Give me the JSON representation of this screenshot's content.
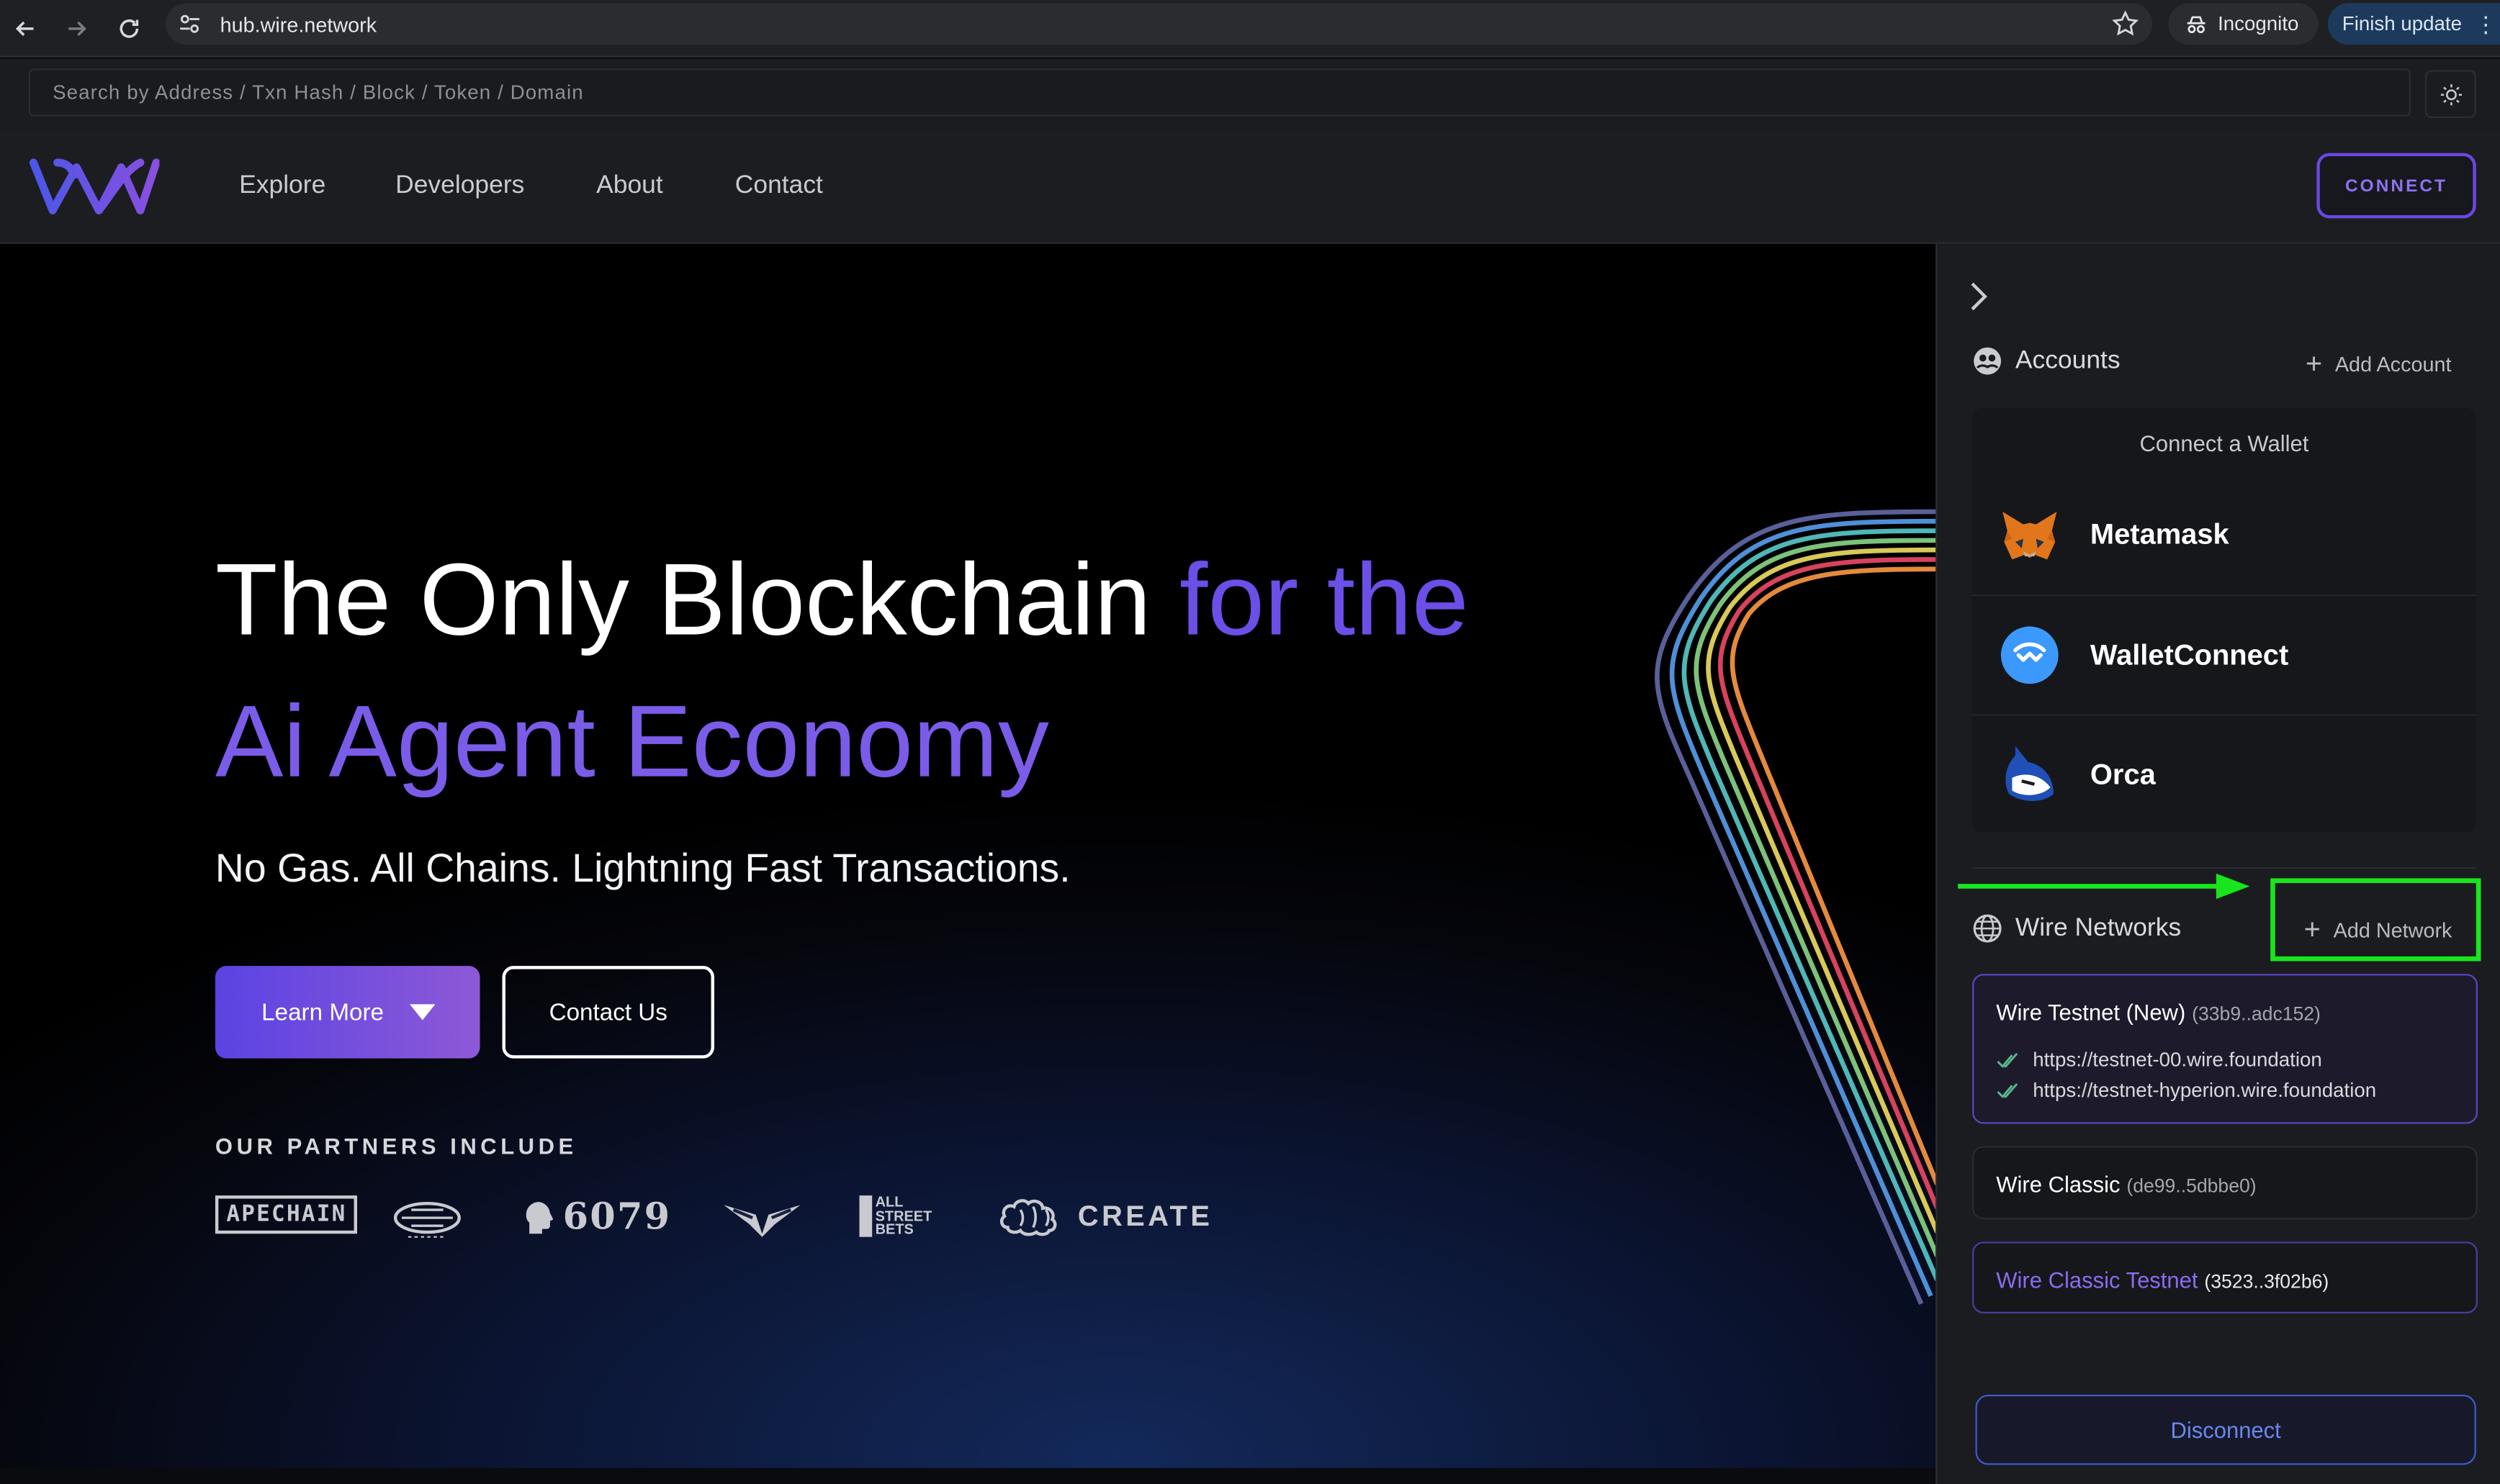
{
  "browser": {
    "url": "hub.wire.network",
    "incognito_label": "Incognito",
    "finish_update_label": "Finish update",
    "menu_glyph": "⋮"
  },
  "search": {
    "placeholder": "Search by Address / Txn Hash / Block / Token / Domain"
  },
  "header": {
    "nav": [
      "Explore",
      "Developers",
      "About",
      "Contact"
    ],
    "connect_label": "CONNECT"
  },
  "hero": {
    "headline_part1": "The Only Blockchain ",
    "headline_part2": "for the",
    "headline_line2": "Ai Agent Economy",
    "subheadline": "No Gas. All Chains. Lightning Fast Transactions.",
    "learn_more_label": "Learn More",
    "contact_us_label": "Contact Us",
    "partners_title": "OUR PARTNERS INCLUDE",
    "partners": [
      "APECHAIN",
      "6079",
      "ALL STREET BETS",
      "CREATE"
    ]
  },
  "panel": {
    "accounts_title": "Accounts",
    "add_account_label": "Add Account",
    "connect_wallet_label": "Connect a Wallet",
    "wallets": [
      "Metamask",
      "WalletConnect",
      "Orca"
    ],
    "networks_title": "Wire Networks",
    "add_network_label": "Add Network",
    "networks": [
      {
        "name": "Wire Testnet (New)",
        "id": "(33b9..adc152)",
        "endpoints": [
          "https://testnet-00.wire.foundation",
          "https://testnet-hyperion.wire.foundation"
        ]
      },
      {
        "name": "Wire Classic",
        "id": "(de99..5dbbe0)"
      },
      {
        "name": "Wire Classic Testnet",
        "id": "(3523..3f02b6)"
      }
    ],
    "disconnect_label": "Disconnect"
  },
  "colors": {
    "accent": "#6b47e0",
    "highlight_annotation": "#18e51e",
    "disconnect_blue": "#3e5bd0"
  }
}
